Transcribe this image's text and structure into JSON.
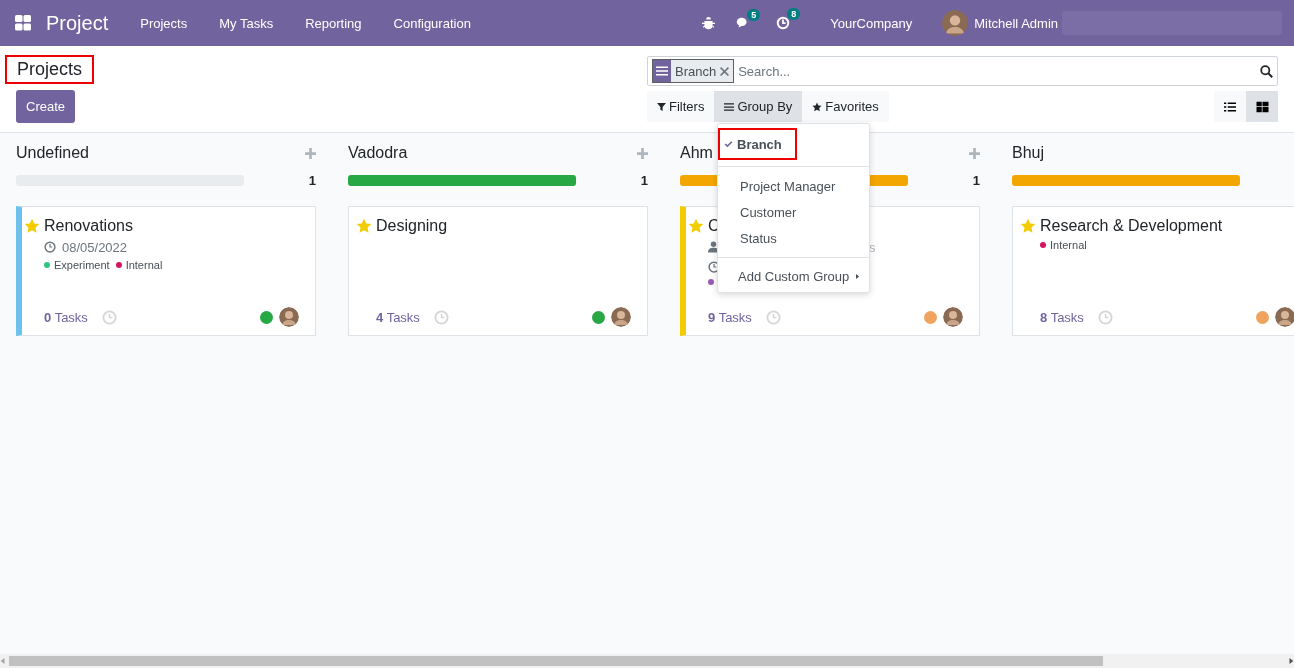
{
  "navbar": {
    "app_name": "Project",
    "menu": [
      "Projects",
      "My Tasks",
      "Reporting",
      "Configuration"
    ],
    "messages_badge": "5",
    "activities_badge": "8",
    "company": "YourCompany",
    "user": "Mitchell Admin"
  },
  "breadcrumb": {
    "label": "Projects",
    "highlighted": true
  },
  "create_button": "Create",
  "search": {
    "facets": [
      {
        "value": "Branch"
      }
    ],
    "placeholder": "Search..."
  },
  "filter_buttons": [
    {
      "kind": "filter",
      "label": "Filters",
      "selected": false
    },
    {
      "kind": "group",
      "label": "Group By",
      "selected": true
    },
    {
      "kind": "favorite",
      "label": "Favorites",
      "selected": false
    }
  ],
  "view_switcher": [
    {
      "kind": "list",
      "selected": false
    },
    {
      "kind": "kanban",
      "selected": true
    }
  ],
  "group_by_menu": {
    "items": [
      {
        "label": "Branch",
        "checked": true,
        "highlighted": true
      },
      {
        "label": "Project Manager",
        "checked": false,
        "highlighted": false
      },
      {
        "label": "Customer",
        "checked": false,
        "highlighted": false
      },
      {
        "label": "Status",
        "checked": false,
        "highlighted": false
      }
    ],
    "custom_group": "Add Custom Group"
  },
  "columns": [
    {
      "title": "Undefined",
      "add_button": true,
      "count": "1",
      "color": "#e9ecef",
      "cards": [
        {
          "name": "Renovations",
          "favorite": true,
          "color": "#6cc1ed",
          "lines": [
            {
              "kind": "date",
              "text": "08/05/2022"
            }
          ],
          "tags": [
            {
              "label": "Experiment",
              "color": "#30c381"
            },
            {
              "label": "Internal",
              "color": "#d6145f"
            }
          ],
          "tasks_count": "0",
          "tasks_label": "Tasks",
          "status": {
            "color": "#28a745"
          }
        }
      ]
    },
    {
      "title": "Vadodra",
      "add_button": true,
      "count": "1",
      "color": "#28a745",
      "cards": [
        {
          "name": "Designing",
          "favorite": true,
          "tasks_count": "4",
          "tasks_label": "Tasks",
          "status": {
            "color": "#28a745"
          }
        }
      ]
    },
    {
      "title": "Ahm",
      "add_button": true,
      "count": "1",
      "color": "#f3a600",
      "cards": [
        {
          "name": "C",
          "favorite": true,
          "color": "#f3cc00",
          "lines": [
            {
              "kind": "manager",
              "text": "s"
            },
            {
              "kind": "date"
            }
          ],
          "tags": [
            {
              "color": "#9b59b6"
            }
          ],
          "tasks_count": "9",
          "tasks_label": "Tasks",
          "status": {
            "color": "#f0a35e"
          }
        }
      ]
    },
    {
      "title": "Bhuj",
      "color": "#f3a600",
      "cards": [
        {
          "name": "Research & Development",
          "favorite": true,
          "tags": [
            {
              "label": "Internal",
              "color": "#d6145f"
            }
          ],
          "tasks_count": "8",
          "tasks_label": "Tasks",
          "status": {
            "color": "#f0a35e"
          }
        }
      ]
    }
  ]
}
